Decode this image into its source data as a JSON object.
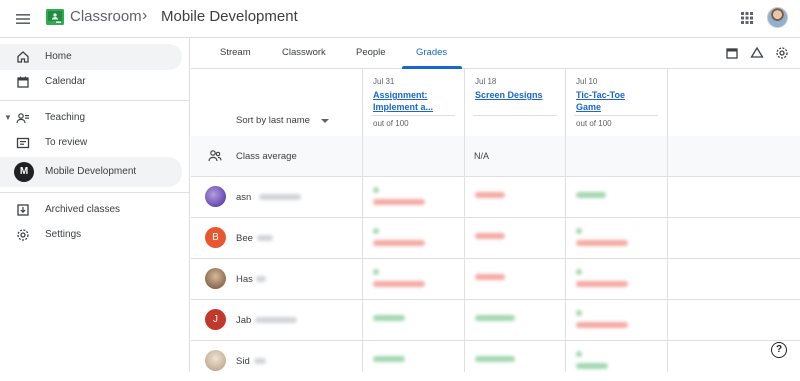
{
  "header": {
    "brand": "Classroom",
    "separator": "›",
    "class_name": "Mobile Development"
  },
  "sidebar": {
    "items": [
      {
        "label": "Home",
        "icon": "home-icon"
      },
      {
        "label": "Calendar",
        "icon": "calendar-icon"
      },
      {
        "label": "Teaching",
        "icon": "teaching-icon"
      },
      {
        "label": "To review",
        "icon": "review-icon"
      },
      {
        "label": "Mobile Development",
        "icon": "class-badge",
        "badge": "M"
      },
      {
        "label": "Archived classes",
        "icon": "archive-icon"
      },
      {
        "label": "Settings",
        "icon": "settings-icon"
      }
    ]
  },
  "tabs": {
    "items": [
      "Stream",
      "Classwork",
      "People",
      "Grades"
    ],
    "active": "Grades"
  },
  "grades": {
    "sort_label": "Sort by last name",
    "columns": [
      {
        "date": "Jul 31",
        "title_line1": "Assignment:",
        "title_line2": "Implement a...",
        "out_of": "out of 100"
      },
      {
        "date": "Jul 18",
        "title_line1": "Screen Designs",
        "title_line2": "",
        "out_of": ""
      },
      {
        "date": "Jul 10",
        "title_line1": "Tic-Tac-Toe",
        "title_line2": "Game",
        "out_of": "out of 100"
      }
    ],
    "class_average_label": "Class average",
    "class_average_values": [
      "",
      "N/A",
      ""
    ],
    "students": [
      {
        "name": "asn",
        "avatar_color": "#6a3fb5",
        "avatar_letter": ""
      },
      {
        "name": "Bee",
        "avatar_color": "#e8572f",
        "avatar_letter": "B"
      },
      {
        "name": "Has",
        "avatar_color": "#8a6a4a",
        "avatar_letter": ""
      },
      {
        "name": "Jab",
        "avatar_color": "#c0392b",
        "avatar_letter": "J"
      },
      {
        "name": "Sid",
        "avatar_color": "#c7b299",
        "avatar_letter": ""
      }
    ]
  },
  "colors": {
    "accent": "#1967d2",
    "active_bg": "#f1f3f4",
    "green": "#34a853",
    "red": "#ea4335"
  },
  "help_label": "?"
}
